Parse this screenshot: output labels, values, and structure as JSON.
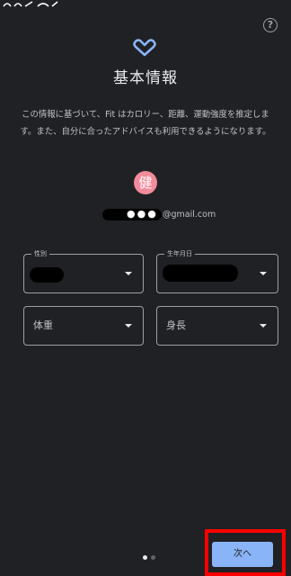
{
  "app": {
    "help_icon": "help-circle-icon",
    "logo_icon": "google-fit-heart-icon",
    "title": "基本情報",
    "description": "この情報に基づいて、Fit はカロリー、距離、運動強度を推定します。また、自分に合ったアドバイスも利用できるようになります。"
  },
  "account": {
    "avatar_letter": "健",
    "email_masked": "●●●",
    "email_suffix": "@gmail.com"
  },
  "fields": {
    "gender_legend": "性別",
    "birthdate_legend": "生年月日",
    "weight_label": "体重",
    "height_label": "身長"
  },
  "pager": {
    "current_page": 1,
    "total_pages": 2
  },
  "footer": {
    "next_label": "次へ"
  },
  "colors": {
    "background": "#202124",
    "accent": "#8ab4f8",
    "avatar": "#f28b9b",
    "highlight": "#ff0000"
  }
}
